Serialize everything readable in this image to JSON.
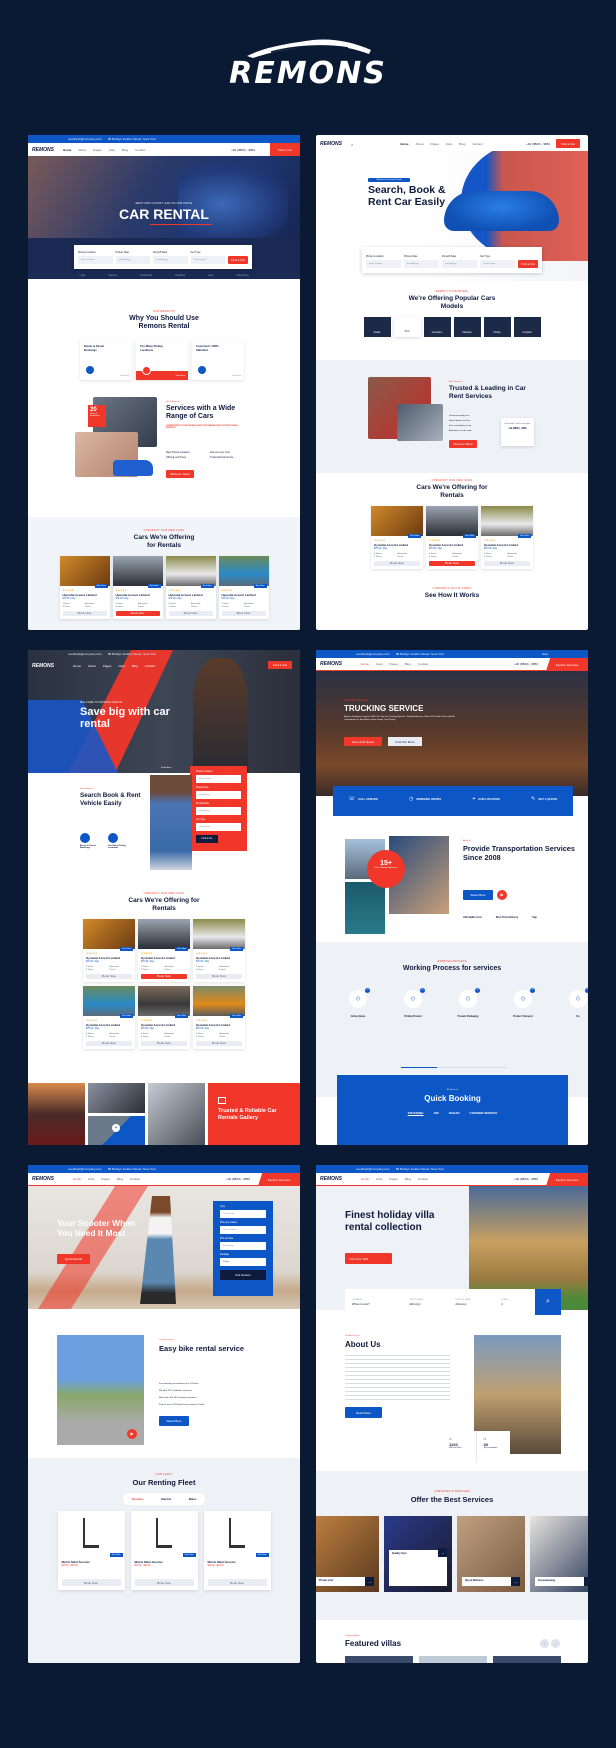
{
  "brand": {
    "name": "REMONS",
    "icon": "car-silhouette-icon"
  },
  "colors": {
    "background": "#0b1a33",
    "accent_red": "#f0372a",
    "accent_blue": "#0d56c6",
    "dark": "#0f1b3d"
  },
  "common_nav": {
    "logo": "REMONS",
    "topbar_email": "needhelp@company.com",
    "topbar_address": "88 Broklyn Golden Street, New York",
    "topbar_links": [
      "Help",
      "Support",
      "Contact"
    ],
    "phone_label": "Call Anytime",
    "phone": "+92 (8800) - 9850",
    "links_v1": [
      "Home",
      "About",
      "Pages",
      "Cars",
      "Blog",
      "Contact"
    ],
    "links_v2": [
      "Home",
      "Cars",
      "Pages",
      "Blog",
      "Contact"
    ],
    "cta_car": "Find a Car",
    "cta_services": "Explore Services"
  },
  "panel1": {
    "kicker": "Rent and luxury car in low price",
    "title": "CAR RENTAL",
    "search_fields": [
      {
        "label": "Pickup Location",
        "placeholder": "Enter location"
      },
      {
        "label": "Pickup Date",
        "placeholder": "mm/dd/yyyy"
      },
      {
        "label": "Dropoff Date",
        "placeholder": "mm/dd/yyyy"
      },
      {
        "label": "Car Type",
        "placeholder": "Choose type"
      }
    ],
    "search_button": "Find a Car",
    "partner_logos": [
      "Logo",
      "Topcars",
      "Dealership",
      "Detailing",
      "Auto",
      "Autoracing"
    ],
    "why_kicker": "Our Benefits",
    "why_title": "Why You Should Use Remons Rental",
    "features": [
      {
        "title": "Easier & Faster Bookings",
        "more": "View More"
      },
      {
        "title": "Too Many Pickup Locations",
        "more": "View More"
      },
      {
        "title": "Customers 100% Satisfied",
        "more": "View More"
      }
    ],
    "services_kicker": "Get to know us",
    "services_title": "Services with a Wide Range of Cars",
    "services_sub": "Committed to providing our customers with exceptional service",
    "experience_number": "20",
    "experience_label": "Years of Experience",
    "services_list": [
      "Many Pickup Locations",
      "New & Luxury Cars",
      "Offering Low Prices",
      "Trusted Rental Service"
    ],
    "services_button": "Discover More",
    "cars_kicker": "Checkout our new cars",
    "cars_title": "Cars We're Offering for Rentals",
    "cars": [
      {
        "name": "Hyundai Accent Limited",
        "price": "$70.00 / Day",
        "tag": "Rent Now",
        "button": "Book Now"
      },
      {
        "name": "Hyundai Accent Limited",
        "price": "$70.00 / Day",
        "tag": "Rent Now",
        "button": "Book Now"
      },
      {
        "name": "Hyundai Accent Limited",
        "price": "$70.00 / Day",
        "tag": "Rent Now",
        "button": "Book Now"
      },
      {
        "name": "Hyundai Accent Limited",
        "price": "$70.00 / Day",
        "tag": "Rent Now",
        "button": "Book Now"
      }
    ],
    "car_specs": [
      "4 Seats",
      "Automatic",
      "4 Doors",
      "Petrol"
    ]
  },
  "panel2": {
    "badge": "Welcome to Remons Rental",
    "title": "Search, Book & Rent Car Easily",
    "models_kicker": "Search your model",
    "models_title": "We're Offering Popular Cars Models",
    "models": [
      "Sedan",
      "SUV",
      "Limousine",
      "Cabriolet",
      "Pickup",
      "Compact"
    ],
    "trusted_kicker": "Get to know us",
    "trusted_title": "Trusted & Leading in Car Rent Services",
    "trusted_list": [
      "Premium quality cars",
      "Expert drivers for hire",
      "Free scheduling on trip",
      "Assistance on the road"
    ],
    "trusted_button": "Discover More",
    "help_text": "Need help? Talk to an Expert",
    "help_phone": "+92 (8800) - 9850",
    "cars_kicker": "Checkout our new cars",
    "cars_title": "Cars We're Offering for Rentals",
    "cars": [
      {
        "name": "Hyundai Accent Limited",
        "price": "$70.00 / Day",
        "tag": "Rent Now",
        "button": "Book Now"
      },
      {
        "name": "Hyundai Accent Limited",
        "price": "$70.00 / Day",
        "tag": "Rent Now",
        "button": "Book Now"
      },
      {
        "name": "Hyundai Accent Limited",
        "price": "$70.00 / Day",
        "tag": "Rent Now",
        "button": "Book Now"
      }
    ],
    "how_kicker": "Comfort & quick steps",
    "how_title": "See How It Works"
  },
  "panel3": {
    "kicker": "Welcome to Remons Rental",
    "title": "Save big with car rental",
    "scroll_label": "Scroll down",
    "form_fields": [
      "Pickup Location",
      "Pickup Date",
      "Dropoff Date",
      "Car Type"
    ],
    "form_values": [
      "Enter location",
      "mm/dd/yyyy",
      "mm/dd/yyyy",
      "Choose type"
    ],
    "form_button": "Find a Car",
    "about_kicker": "Get to know us",
    "about_title": "Search Book & Rent Vehicle Easily",
    "about_features": [
      "Easier & Faster Bookings",
      "Too Many Pickup Locations"
    ],
    "cars_kicker": "Checkout our new cars",
    "cars_title": "Cars We're Offering for Rentals",
    "cars": [
      {
        "name": "Hyundai Accent Limited",
        "price": "$70.00 / Day",
        "tag": "Rent Now",
        "button": "Book Now"
      },
      {
        "name": "Hyundai Accent Limited",
        "price": "$70.00 / Day",
        "tag": "Rent Now",
        "button": "Book Now"
      },
      {
        "name": "Hyundai Accent Limited",
        "price": "$70.00 / Day",
        "tag": "Rent Now",
        "button": "Book Now"
      },
      {
        "name": "Hyundai Accent Limited",
        "price": "$70.00 / Day",
        "tag": "Rent Now",
        "button": "Book Now"
      },
      {
        "name": "Hyundai Accent Limited",
        "price": "$70.00 / Day",
        "tag": "Rent Now",
        "button": "Book Now"
      },
      {
        "name": "Hyundai Accent Limited",
        "price": "$70.00 / Day",
        "tag": "Rent Now",
        "button": "Book Now"
      }
    ],
    "gallery_title": "Trusted & Reliable Car Rentals Gallery"
  },
  "panel4": {
    "kicker": "Transport your goods",
    "title": "TRUCKING SERVICE",
    "description": "Explore Seamless Logistics With Our Top-Tier Trucking Service. Timely Deliveries, State-Of-The-Art Trucks, And A Commitment To Excellence Have Swept, Our Priority.",
    "btn_quote": "Get A Full Quote",
    "btn_find": "Find Out More",
    "info": [
      {
        "title": "CALL CENTER",
        "icon": "headset-icon"
      },
      {
        "title": "WORKING HOURS",
        "icon": "clock-icon"
      },
      {
        "title": "OUR LOCATION",
        "icon": "location-pin-icon"
      },
      {
        "title": "GET A QUOTE",
        "icon": "quote-icon"
      }
    ],
    "about_kicker": "About Us",
    "about_title": "Provide Transportation Services Since 2008",
    "experience_number": "15+",
    "experience_label": "Years Working Experience",
    "about_button": "Read More",
    "about_features": [
      "Affordable Cost",
      "Shot Time Delivery",
      "Sup"
    ],
    "process_kicker": "Working Process",
    "process_title": "Working Process for services",
    "process_steps": [
      {
        "num": "01",
        "title": "Online Quote"
      },
      {
        "num": "02",
        "title": "Picking Product"
      },
      {
        "num": "03",
        "title": "Product Packaging"
      },
      {
        "num": "04",
        "title": "Product Transport"
      },
      {
        "num": "05",
        "title": "De"
      }
    ],
    "booking_kicker": "All Services",
    "booking_title": "Quick Booking",
    "booking_tabs": [
      "TRUCKING",
      "AIR",
      "OCEAN",
      "COURIER SERVICE"
    ]
  },
  "panel5": {
    "title": "Your Scooter When You Need It Most",
    "hero_button": "Quick Rental",
    "form_fields": [
      {
        "label": "Type",
        "value": "Choose Type"
      },
      {
        "label": "Pick-up Location",
        "value": "Select Location"
      },
      {
        "label": "Pick-up Date",
        "value": "dd/mm/yyyy"
      },
      {
        "label": "Package",
        "value": "1 Hour"
      }
    ],
    "form_button": "Find Scooters",
    "about_kicker": "The best for you",
    "about_title": "Easy bike rental service",
    "about_list": [
      "Free booking cancellation up to 24 hours",
      "We offer 24/7 roadside assistance",
      "More than 100,000 satisfied customers",
      "Fleet of over 5,000 brand new scooters & bikes"
    ],
    "about_button": "Read More",
    "fleet_kicker": "Our Fleet",
    "fleet_title": "Our Renting Fleet",
    "fleet_tabs": [
      "Scooters",
      "Electric",
      "Bikes"
    ],
    "fleet": [
      {
        "name": "Metric Maxi Scooter",
        "price": "$10.00 - $30.00",
        "tag": "Rent Now",
        "button": "Book Now"
      },
      {
        "name": "Metric Maxi Scooter",
        "price": "$10.00 - $30.00",
        "tag": "Rent Now",
        "button": "Book Now"
      },
      {
        "name": "Metric Maxi Scooter",
        "price": "$10.00 - $30.00",
        "tag": "Rent Now",
        "button": "Book Now"
      }
    ]
  },
  "panel6": {
    "title": "Finest holiday villa rental collection",
    "hero_button": "Find Your Villa",
    "search_fields": [
      {
        "label": "LOCATION",
        "value": "Where to next?"
      },
      {
        "label": "PICK UP DATE",
        "value": "dd/mm/yy"
      },
      {
        "label": "DROP OF DATE",
        "value": "dd/mm/yy"
      },
      {
        "label": "GUEST",
        "value": "2"
      }
    ],
    "about_kicker": "The best for you",
    "about_title": "About Us",
    "about_button": "Read More",
    "stats": [
      {
        "value": "1120",
        "label": "Villas for Rent"
      },
      {
        "value": "30",
        "label": "Top Destination"
      }
    ],
    "services_kicker": "Amenities & services",
    "services_title": "Offer the Best Services",
    "services": [
      "Private chef",
      "Quality Gym",
      "Spa & Wellness",
      "Housekeeping"
    ],
    "featured_kicker": "Trending Rooms",
    "featured_title": "Featured villas"
  }
}
